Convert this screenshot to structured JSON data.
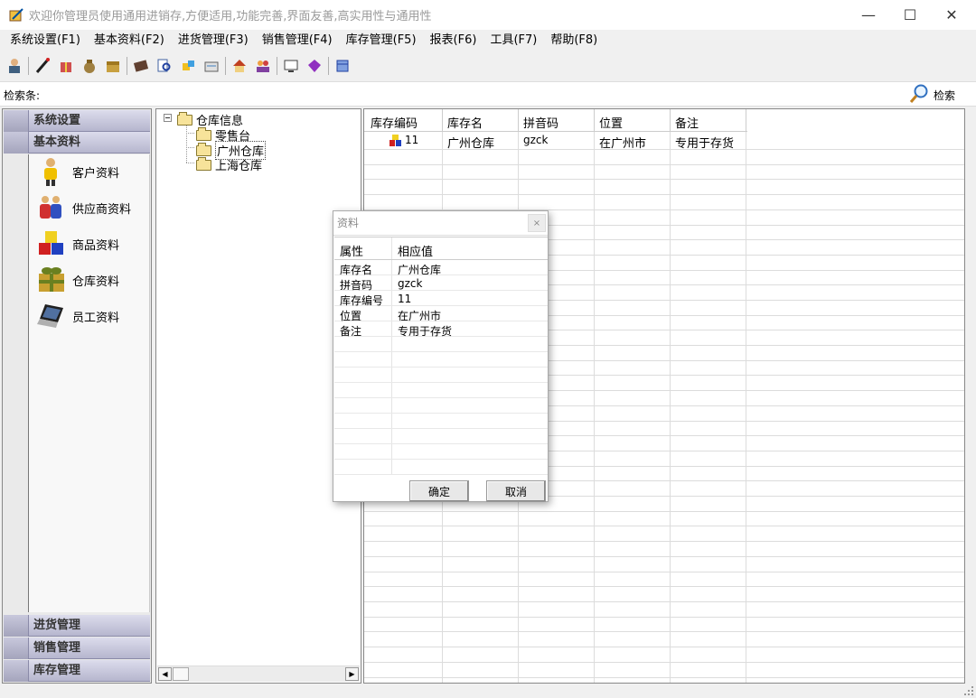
{
  "window": {
    "title": "欢迎你管理员使用通用进销存,方便适用,功能完善,界面友善,高实用性与通用性"
  },
  "menu": [
    "系统设置(F1)",
    "基本资料(F2)",
    "进货管理(F3)",
    "销售管理(F4)",
    "库存管理(F5)",
    "报表(F6)",
    "工具(F7)",
    "帮助(F8)"
  ],
  "toolbar_icons": [
    "user-icon",
    "pen-icon",
    "gift-icon",
    "bag-icon",
    "box-icon",
    "book-icon",
    "search-doc-icon",
    "package-icon",
    "folder-icon",
    "home-icon",
    "people-icon",
    "monitor-icon",
    "gem-icon",
    "window-icon"
  ],
  "search": {
    "label": "检索条:",
    "value": "",
    "button": "检索"
  },
  "sidebar": {
    "sections_top": [
      "系统设置",
      "基本资料"
    ],
    "items": [
      "客户资料",
      "供应商资料",
      "商品资料",
      "仓库资料",
      "员工资料"
    ],
    "sections_bottom": [
      "进货管理",
      "销售管理",
      "库存管理"
    ]
  },
  "tree": {
    "root": "仓库信息",
    "children": [
      "零售台",
      "广州仓库",
      "上海仓库"
    ],
    "selected": "广州仓库"
  },
  "grid": {
    "columns": [
      "库存编码",
      "库存名",
      "拼音码",
      "位置",
      "备注"
    ],
    "rows": [
      [
        "11",
        "广州仓库",
        "gzck",
        "在广州市",
        "专用于存货"
      ]
    ]
  },
  "dialog": {
    "title": "资料",
    "close": "×",
    "header": [
      "属性",
      "相应值"
    ],
    "rows": [
      [
        "库存名",
        "广州仓库"
      ],
      [
        "拼音码",
        "gzck"
      ],
      [
        "库存编号",
        "11"
      ],
      [
        "位置",
        "在广州市"
      ],
      [
        "备注",
        "专用于存货"
      ]
    ],
    "ok": "确定",
    "cancel": "取消"
  },
  "colors": {
    "section": "#c8c8dc",
    "selected": "#0a64c8"
  }
}
